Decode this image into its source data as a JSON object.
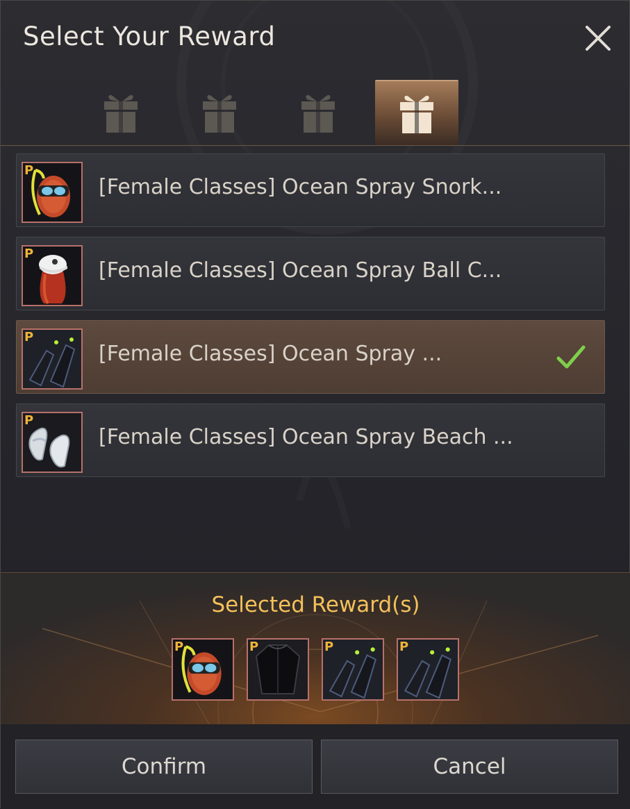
{
  "dialog": {
    "title": "Select Your Reward",
    "close_icon": "close-icon"
  },
  "tabs": [
    {
      "icon": "gift-box-icon",
      "active": false
    },
    {
      "icon": "gift-box-icon",
      "active": false
    },
    {
      "icon": "gift-box-icon",
      "active": false
    },
    {
      "icon": "gift-box-icon",
      "active": true
    }
  ],
  "rewards": [
    {
      "label": "[Female Classes] Ocean Spray Snork...",
      "badge": "P",
      "icon": "snorkel-mask-icon",
      "selected": false
    },
    {
      "label": "[Female Classes] Ocean Spray Ball C...",
      "badge": "P",
      "icon": "ball-cap-icon",
      "selected": false
    },
    {
      "label": "[Female Classes] Ocean Spray ...",
      "badge": "P",
      "icon": "swim-fins-icon",
      "selected": true
    },
    {
      "label": "[Female Classes] Ocean Spray Beach ...",
      "badge": "P",
      "icon": "beach-sandals-icon",
      "selected": false
    }
  ],
  "selected_section": {
    "title": "Selected Reward(s)",
    "items": [
      {
        "badge": "P",
        "icon": "snorkel-mask-icon"
      },
      {
        "badge": "P",
        "icon": "wetsuit-icon"
      },
      {
        "badge": "P",
        "icon": "swim-fins-icon"
      },
      {
        "badge": "P",
        "icon": "swim-fins-icon"
      }
    ]
  },
  "buttons": {
    "confirm": "Confirm",
    "cancel": "Cancel"
  },
  "colors": {
    "accent_gold": "#f3c15a",
    "check_green": "#7ed04a",
    "badge_gold": "#f0b33a",
    "item_border": "#b7716a"
  }
}
